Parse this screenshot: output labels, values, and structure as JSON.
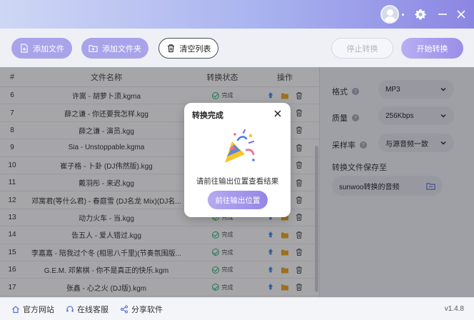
{
  "window": {
    "title_icons": [
      "user-avatar",
      "gear-icon",
      "minimize-icon",
      "close-icon"
    ]
  },
  "toolbar": {
    "add_file": "添加文件",
    "add_folder": "添加文件夹",
    "clear_list": "清空列表",
    "stop_convert": "停止转换",
    "start_convert": "开始转换"
  },
  "table": {
    "headers": {
      "num": "#",
      "name": "文件名称",
      "status": "转换状态",
      "ops": "操作"
    },
    "rows": [
      {
        "num": "6",
        "name": "许嵩 - 胡萝卜须.kgma",
        "status": "完成"
      },
      {
        "num": "7",
        "name": "薛之谦 - 你还要我怎样.kgg",
        "status": "完成"
      },
      {
        "num": "8",
        "name": "薛之谦 - 演员.kgg",
        "status": "完成"
      },
      {
        "num": "9",
        "name": "Sia - Unstoppable.kgma",
        "status": "完成"
      },
      {
        "num": "10",
        "name": "崔子格 - 卜卦 (DJ伟然版).kgg",
        "status": "完成"
      },
      {
        "num": "11",
        "name": "戴羽彤 - 来迟.kgg",
        "status": "完成"
      },
      {
        "num": "12",
        "name": "邓寓君(等什么君) - 春庭雪 (DJ名龙 Mix)(DJ名...",
        "status": "完成"
      },
      {
        "num": "13",
        "name": "动力火车 - 当.kgg",
        "status": "完成"
      },
      {
        "num": "14",
        "name": "告五人 - 爱人错过.kgg",
        "status": "完成"
      },
      {
        "num": "15",
        "name": "李嘉嘉 - 陪我过个冬 (相思八千里)(节奏氛围版...",
        "status": "完成"
      },
      {
        "num": "16",
        "name": "G.E.M. 邓紫棋 - 你不是真正的快乐.kgm",
        "status": "完成"
      },
      {
        "num": "17",
        "name": "张鑫 - 心之火 (DJ版).kgm",
        "status": "完成"
      }
    ]
  },
  "settings": {
    "format_label": "格式",
    "format_value": "MP3",
    "quality_label": "质量",
    "quality_value": "256Kbps",
    "samplerate_label": "采样率",
    "samplerate_value": "与源音频一致",
    "save_label": "转换文件保存至",
    "save_path": "sunwoo转换的音频"
  },
  "footer": {
    "website": "官方网站",
    "support": "在线客服",
    "share": "分享软件",
    "version": "v1.4.8"
  },
  "modal": {
    "title": "转换完成",
    "message": "请前往输出位置查看结果",
    "button": "前往输出位置"
  },
  "colors": {
    "accent": "#9a8ee8",
    "success": "#27b06b",
    "folder": "#f0a81c",
    "pin": "#4a8de8"
  }
}
